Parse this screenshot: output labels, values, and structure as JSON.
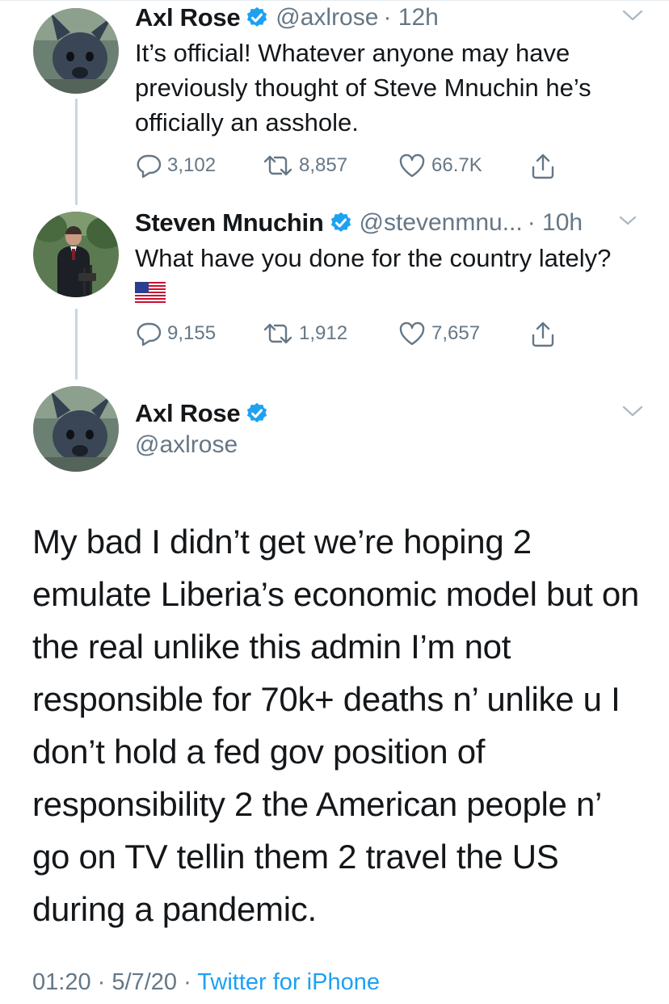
{
  "tweets": [
    {
      "name": "Axl Rose",
      "handle": "@axlrose",
      "time": "· 12h",
      "text": "It’s official! Whatever anyone may have previously thought of Steve Mnuchin he’s officially an asshole.",
      "replies": "3,102",
      "retweets": "8,857",
      "likes": "66.7K"
    },
    {
      "name": "Steven Mnuchin",
      "handle": "@stevenmnu...",
      "time": "· 10h",
      "text": "What have you done for the country lately?",
      "emoji": "us-flag-emoji",
      "replies": "9,155",
      "retweets": "1,912",
      "likes": "7,657"
    }
  ],
  "main_tweet": {
    "name": "Axl Rose",
    "handle": "@axlrose",
    "text": "My bad I didn’t get we’re hoping 2 emulate Liberia’s economic model but on the real unlike this admin I’m not responsible for 70k+ deaths n’ unlike u I don’t hold a fed gov position of responsibility 2 the American people n’ go on TV tellin them 2 travel the US during a pandemic.",
    "time": "01:20",
    "date": "5/7/20",
    "separator": "·",
    "source": "Twitter for iPhone"
  },
  "colors": {
    "accent": "#1da1f2",
    "muted": "#657786",
    "text": "#14171a",
    "thread_line": "#ccd6dd"
  },
  "icons": [
    "reply-icon",
    "retweet-icon",
    "like-icon",
    "share-icon",
    "verified-badge-icon",
    "chevron-down-icon"
  ]
}
